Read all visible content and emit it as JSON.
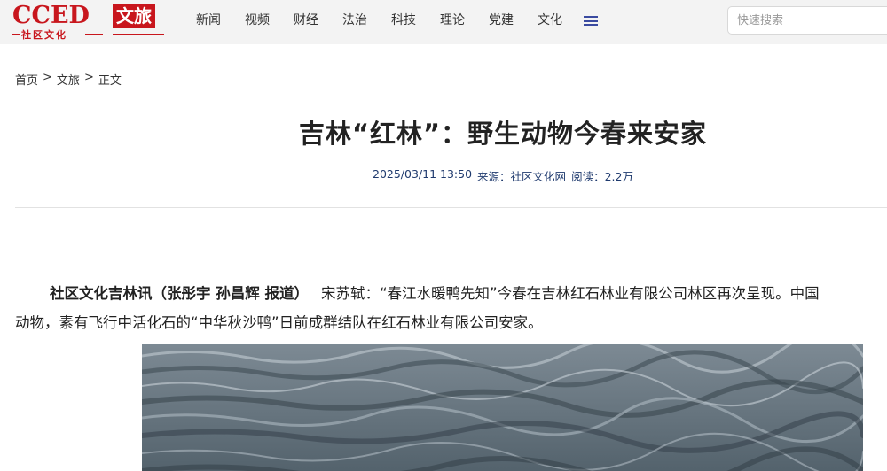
{
  "brand": {
    "logo_text": "CCED",
    "badge": "文旅",
    "subtitle": "社区文化",
    "color": "#c8161d"
  },
  "nav": {
    "items": [
      "新闻",
      "视频",
      "财经",
      "法治",
      "科技",
      "理论",
      "党建",
      "文化"
    ],
    "menu_icon": "hamburger-icon"
  },
  "search": {
    "placeholder": "快速搜索"
  },
  "breadcrumb": {
    "home": "首页",
    "section": "文旅",
    "current": "正文",
    "separator": ">"
  },
  "article": {
    "title": "吉林“红林”：野生动物今春来安家",
    "date": "2025/03/11 13:50",
    "source": "来源：社区文化网",
    "reads": "阅读：2.2万",
    "byline": "社区文化吉林讯（张彤宇 孙昌辉 报道）",
    "lead": "宋苏轼：“春江水暖鸭先知”今春在吉林红石林业有限公司林区再次呈现。中国",
    "lead_cont": "动物，素有飞行中活化石的“中华秋沙鸭”日前成群结队在红石林业有限公司安家。"
  },
  "colors": {
    "header_bg": "#f3f3f3",
    "meta_text": "#1f3a6e",
    "water": "#5d6c78"
  }
}
